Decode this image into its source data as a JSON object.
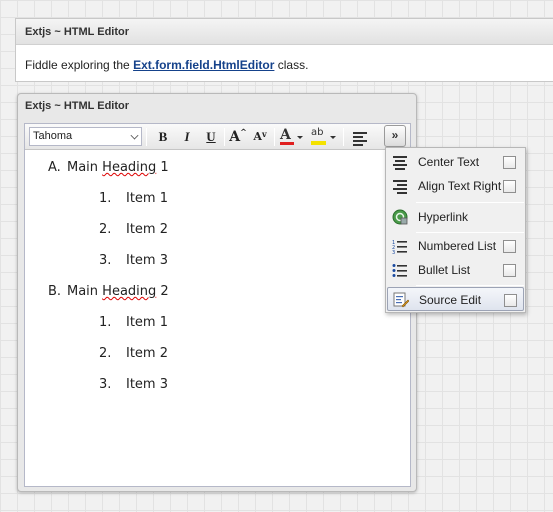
{
  "info_panel": {
    "title": "Extjs ~ HTML Editor",
    "text_before": "Fiddle exploring the ",
    "link_text": "Ext.form.field.HtmlEditor",
    "text_after": " class."
  },
  "editor_window": {
    "title": "Extjs ~ HTML Editor",
    "toolbar": {
      "font_family_value": "Tahoma",
      "bold": "B",
      "italic": "I",
      "underline": "U",
      "grow_font": "A",
      "shrink_font": "A",
      "font_color": "A",
      "highlight": "ab",
      "more_button": "»",
      "font_color_swatch": "#e02020",
      "highlight_swatch": "#f4e200"
    },
    "content": [
      {
        "marker": "A.",
        "heading_pre": "Main ",
        "heading_misspelled": "Heading",
        "heading_post": " 1",
        "items": [
          {
            "num": "1.",
            "text": "Item 1"
          },
          {
            "num": "2.",
            "text": "Item 2"
          },
          {
            "num": "3.",
            "text": "Item 3"
          }
        ]
      },
      {
        "marker": "B.",
        "heading_pre": "Main ",
        "heading_misspelled": "Heading",
        "heading_post": " 2",
        "items": [
          {
            "num": "1.",
            "text": "Item 1"
          },
          {
            "num": "2.",
            "text": "Item 2"
          },
          {
            "num": "3.",
            "text": "Item 3"
          }
        ]
      }
    ]
  },
  "overflow_menu": {
    "items": [
      {
        "label": "Center Text",
        "icon": "align-center-icon",
        "checkbox": true
      },
      {
        "label": "Align Text Right",
        "icon": "align-right-icon",
        "checkbox": true
      },
      {
        "label": "Hyperlink",
        "icon": "hyperlink-icon",
        "checkbox": false
      },
      {
        "label": "Numbered List",
        "icon": "numbered-list-icon",
        "checkbox": true
      },
      {
        "label": "Bullet List",
        "icon": "bullet-list-icon",
        "checkbox": true
      },
      {
        "label": "Source Edit",
        "icon": "source-edit-icon",
        "checkbox": true
      }
    ]
  }
}
